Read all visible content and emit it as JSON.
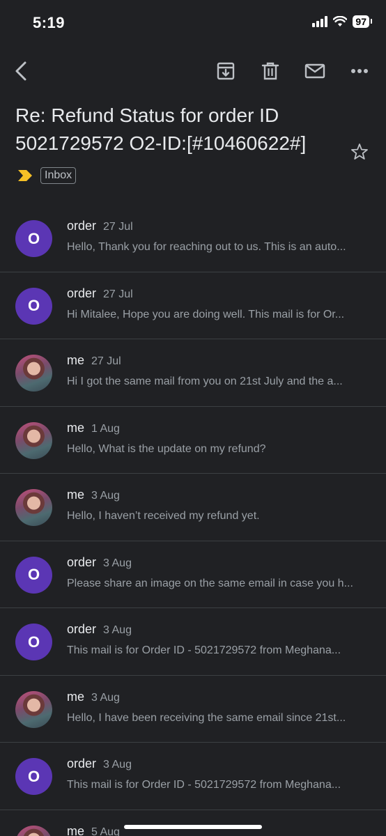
{
  "status_bar": {
    "time": "5:19",
    "battery": "97"
  },
  "toolbar": {
    "back_icon": "chevron-left-icon",
    "archive_icon": "archive-icon",
    "delete_icon": "trash-icon",
    "mark_unread_icon": "mail-icon",
    "more_icon": "more-horizontal-icon"
  },
  "subject": "Re:  Refund Status for order ID 5021729572 O2-ID:[#10460622#]",
  "labels": {
    "importance_icon": "important-marker-icon",
    "importance_color": "#f6c026",
    "inbox": "Inbox"
  },
  "colors": {
    "avatar_letter_bg": "#5b36b4",
    "background": "#202124",
    "divider": "#3c4043"
  },
  "messages": [
    {
      "sender": "order",
      "date": "27 Jul",
      "avatar": "O",
      "snippet": "Hello, Thank you for reaching out to us. This is an auto..."
    },
    {
      "sender": "order",
      "date": "27 Jul",
      "avatar": "O",
      "snippet": "Hi Mitalee, Hope you are doing well. This mail is for Or..."
    },
    {
      "sender": "me",
      "date": "27 Jul",
      "avatar": "",
      "snippet": "Hi I got the same mail from you on 21st July and the a..."
    },
    {
      "sender": "me",
      "date": "1 Aug",
      "avatar": "",
      "snippet": "Hello, What is the update on my refund?"
    },
    {
      "sender": "me",
      "date": "3 Aug",
      "avatar": "",
      "snippet": "Hello, I haven’t received my refund yet."
    },
    {
      "sender": "order",
      "date": "3 Aug",
      "avatar": "O",
      "snippet": "Please share an image on the same email in case you h..."
    },
    {
      "sender": "order",
      "date": "3 Aug",
      "avatar": "O",
      "snippet": "This mail is for Order ID - 5021729572 from Meghana..."
    },
    {
      "sender": "me",
      "date": "3 Aug",
      "avatar": "",
      "snippet": "Hello, I have been receiving the same email since 21st..."
    },
    {
      "sender": "order",
      "date": "3 Aug",
      "avatar": "O",
      "snippet": "This mail is for Order ID - 5021729572 from Meghana..."
    },
    {
      "sender": "me",
      "date": "5 Aug",
      "avatar": "",
      "snippet": ""
    }
  ]
}
